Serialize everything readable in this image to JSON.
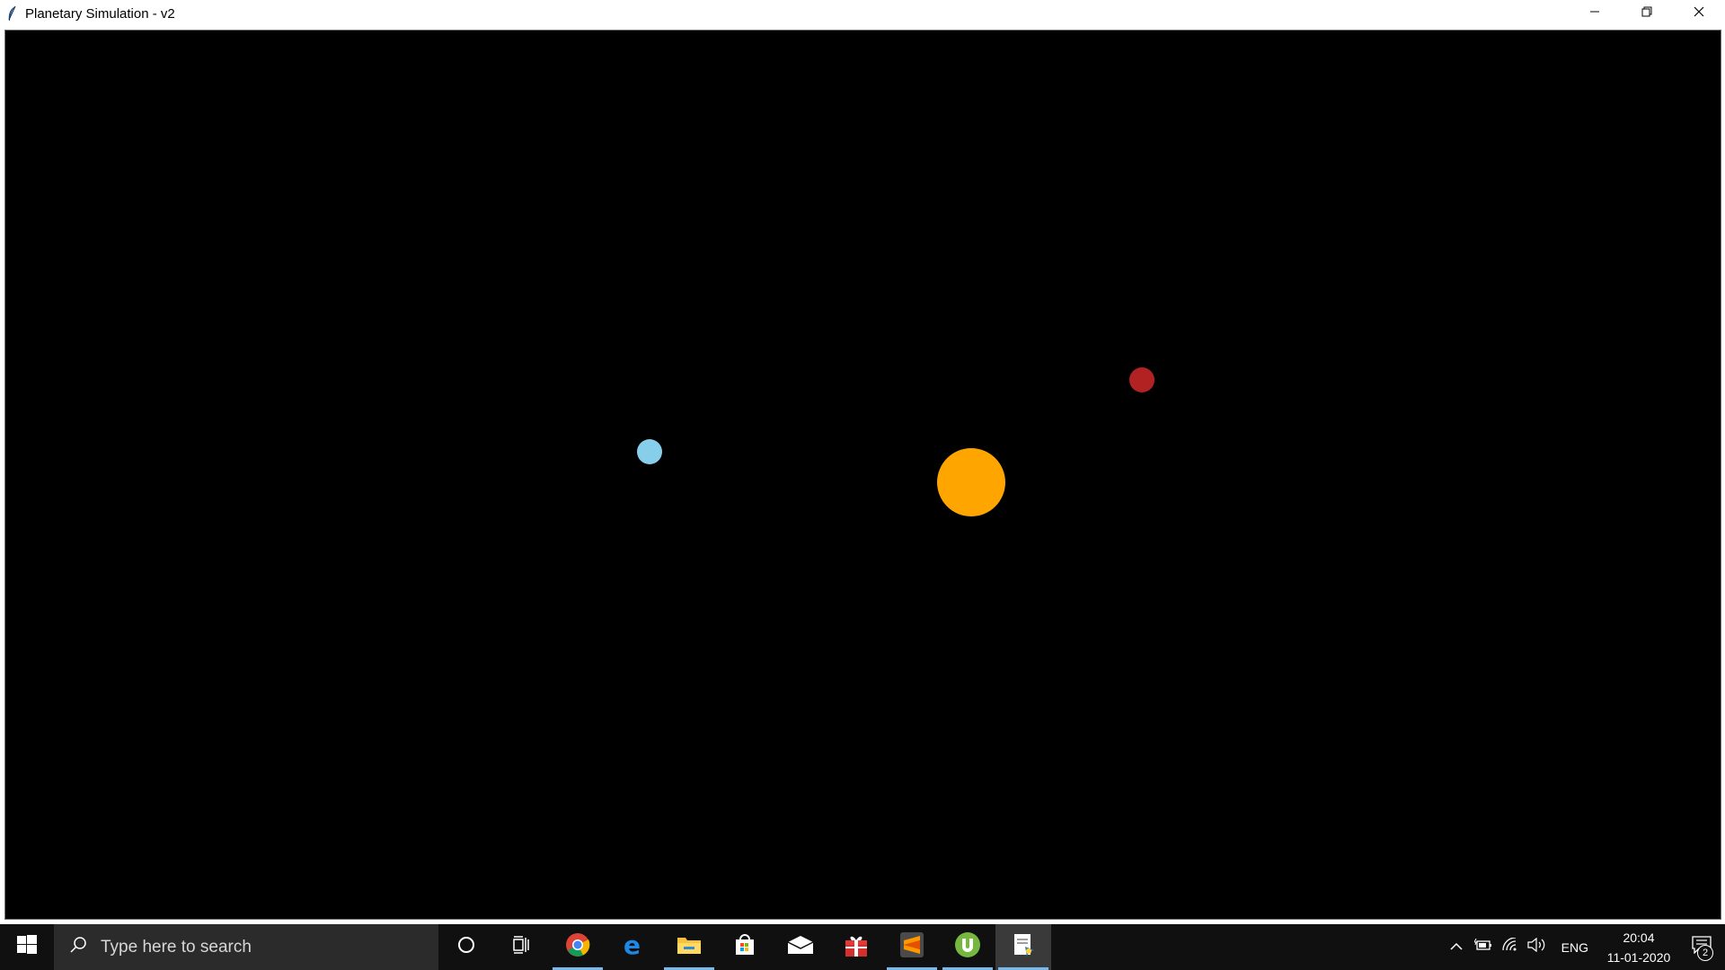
{
  "window": {
    "title": "Planetary Simulation - v2",
    "icon": "feather-icon",
    "controls": [
      "minimize-icon",
      "restore-icon",
      "close-icon"
    ]
  },
  "canvas": {
    "background": "#000000",
    "bodies": [
      {
        "name": "sun",
        "color": "#FFA500"
      },
      {
        "name": "blue-planet",
        "color": "#87CEEB"
      },
      {
        "name": "red-planet",
        "color": "#B22222"
      }
    ]
  },
  "taskbar": {
    "search": {
      "placeholder": "Type here to search"
    },
    "pinned": [
      "cortana-icon",
      "task-view-icon",
      "chrome-icon",
      "edge-icon",
      "file-explorer-icon",
      "store-icon",
      "mail-icon",
      "gift-icon",
      "sublime-text-icon",
      "utorrent-icon",
      "python-tk-icon"
    ],
    "tray": {
      "language": "ENG",
      "time": "20:04",
      "date": "11-01-2020",
      "notification_count": "2"
    }
  }
}
